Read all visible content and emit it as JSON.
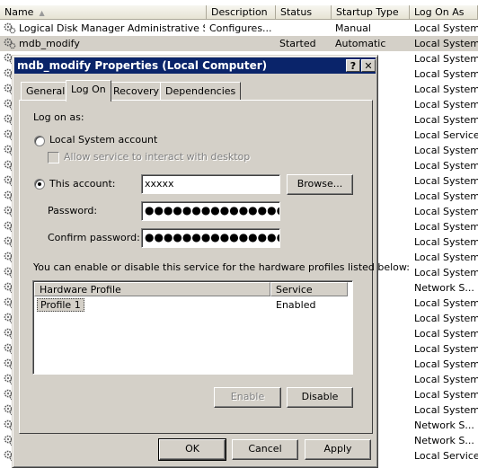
{
  "services": {
    "columns": {
      "name": "Name",
      "description": "Description",
      "status": "Status",
      "startup_type": "Startup Type",
      "log_on_as": "Log On As"
    },
    "rows": [
      {
        "name": "Logical Disk Manager Administrative Ser...",
        "description": "Configures...",
        "status": "",
        "startup_type": "Manual",
        "log_on_as": "Local System",
        "selected": false
      },
      {
        "name": "mdb_modify",
        "description": "",
        "status": "Started",
        "startup_type": "Automatic",
        "log_on_as": "Local System",
        "selected": true
      }
    ],
    "logon_column_more": [
      "Local System",
      "Local System",
      "Local System",
      "Local System",
      "Local System",
      "Local Service",
      "Local System",
      "Local System",
      "Local System",
      "Local System",
      "Local System",
      "Local System",
      "Local System",
      "Local System",
      "Local System",
      "Network S...",
      "Local System",
      "Local System",
      "Local System",
      "Local System",
      "Local System",
      "Local System",
      "Local System",
      "Local System",
      "Network S...",
      "Network S...",
      "Local Service"
    ]
  },
  "dialog": {
    "title": "mdb_modify Properties (Local Computer)",
    "help_button": "?",
    "close_button": "✕",
    "tabs": [
      "General",
      "Log On",
      "Recovery",
      "Dependencies"
    ],
    "active_tab": "Log On",
    "logon": {
      "log_on_as_label": "Log on as:",
      "local_system_label": "Local System account",
      "allow_interact_label": "Allow service to interact with desktop",
      "this_account_label": "This account:",
      "account_value": "xxxxx",
      "browse_label": "Browse...",
      "password_label": "Password:",
      "password_value": "●●●●●●●●●●●●●●●",
      "confirm_label": "Confirm password:",
      "confirm_value": "●●●●●●●●●●●●●●●",
      "selected_option": "this_account",
      "profiles_description": "You can enable or disable this service for the hardware profiles listed below:",
      "profiles_columns": {
        "profile": "Hardware Profile",
        "service": "Service"
      },
      "profiles": [
        {
          "profile": "Profile 1",
          "service": "Enabled"
        }
      ],
      "enable_label": "Enable",
      "disable_label": "Disable"
    },
    "footer": {
      "ok_label": "OK",
      "cancel_label": "Cancel",
      "apply_label": "Apply"
    }
  },
  "colors": {
    "titlebar": "#0a246a",
    "face": "#d4d0c8",
    "selection_row": "#d4d0c8"
  }
}
